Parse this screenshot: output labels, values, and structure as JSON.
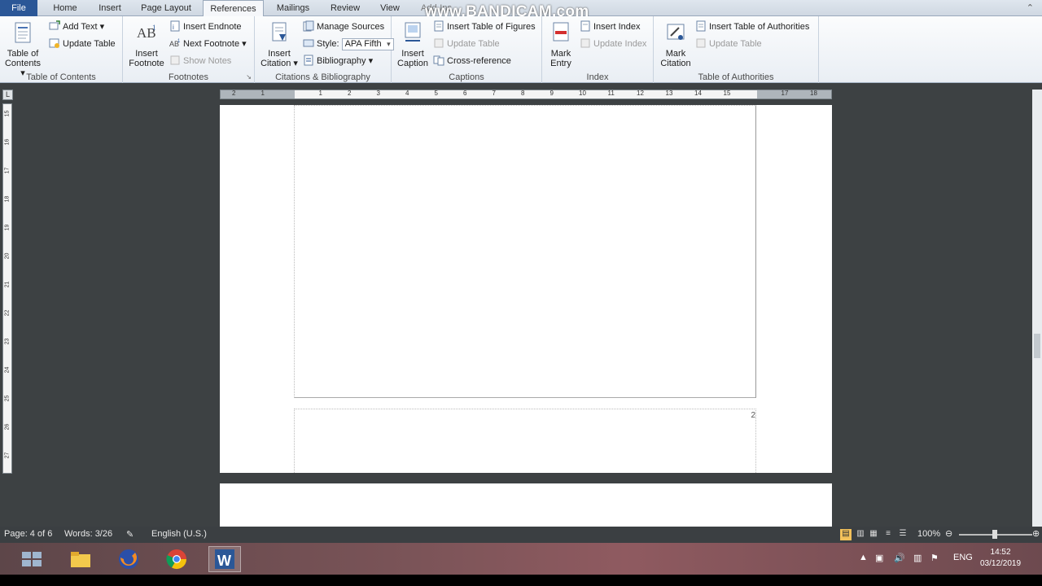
{
  "tabs": [
    {
      "label": "File"
    },
    {
      "label": "Home"
    },
    {
      "label": "Insert"
    },
    {
      "label": "Page Layout"
    },
    {
      "label": "References"
    },
    {
      "label": "Mailings"
    },
    {
      "label": "Review"
    },
    {
      "label": "View"
    },
    {
      "label": "Add-Ins"
    }
  ],
  "watermark": "www.BANDICAM.com",
  "ribbon": {
    "toc": {
      "label": "Table of Contents",
      "table_of_contents": "Table of Contents",
      "add_text": "Add Text",
      "update_table": "Update Table"
    },
    "footnotes": {
      "label": "Footnotes",
      "insert_footnote": "Insert Footnote",
      "insert_endnote": "Insert Endnote",
      "next_footnote": "Next Footnote",
      "show_notes": "Show Notes"
    },
    "citations": {
      "label": "Citations & Bibliography",
      "insert_citation": "Insert Citation",
      "manage_sources": "Manage Sources",
      "style_label": "Style:",
      "style_value": "APA Fifth",
      "bibliography": "Bibliography"
    },
    "captions": {
      "label": "Captions",
      "insert_caption": "Insert Caption",
      "insert_table_of_figures": "Insert Table of Figures",
      "update_table": "Update Table",
      "cross_reference": "Cross-reference"
    },
    "index": {
      "label": "Index",
      "mark_entry": "Mark Entry",
      "insert_index": "Insert Index",
      "update_index": "Update Index"
    },
    "authorities": {
      "label": "Table of Authorities",
      "mark_citation": "Mark Citation",
      "insert_table_of_authorities": "Insert Table of Authorities",
      "update_table": "Update Table"
    }
  },
  "document": {
    "page_number": "2"
  },
  "status": {
    "page": "Page: 4 of 6",
    "words": "Words: 3/26",
    "language": "English (U.S.)",
    "zoom": "100%"
  },
  "taskbar": {
    "lang": "ENG",
    "time": "14:52",
    "date": "03/12/2019"
  },
  "colors": {
    "file_tab": "#2b5797",
    "workspace": "#3d4143",
    "taskbar": "#7b5458"
  }
}
